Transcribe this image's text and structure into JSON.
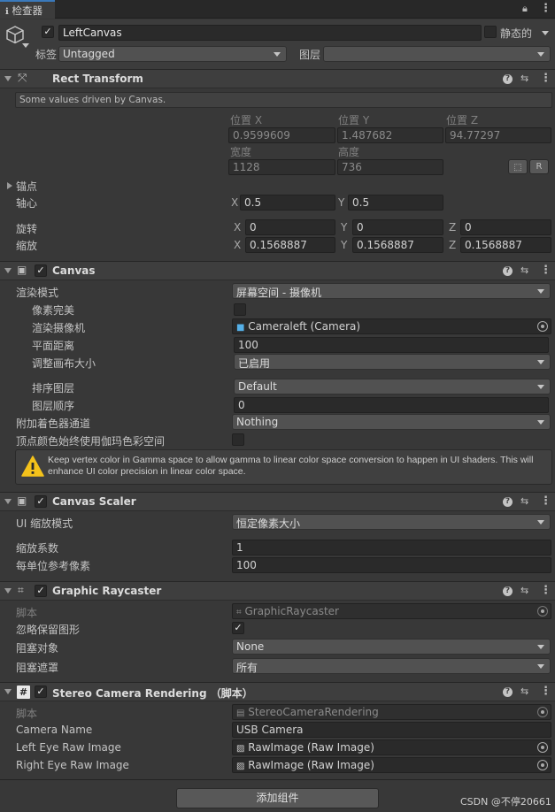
{
  "tab": {
    "label": "检查器"
  },
  "object": {
    "name": "LeftCanvas",
    "static_label": "静态的",
    "tag_label": "标签",
    "tag_value": "Untagged",
    "layer_label": "图层",
    "layer_value": ""
  },
  "rect_transform": {
    "title": "Rect Transform",
    "driven_note": "Some values driven by Canvas.",
    "pos_x_label": "位置 X",
    "pos_y_label": "位置 Y",
    "pos_z_label": "位置 Z",
    "pos_x": "0.9599609",
    "pos_y": "1.487682",
    "pos_z": "94.77297",
    "width_label": "宽度",
    "height_label": "高度",
    "width": "1128",
    "height": "736",
    "r_button": "R",
    "anchor_label": "锚点",
    "pivot_label": "轴心",
    "pivot_x": "0.5",
    "pivot_y": "0.5",
    "rotation_label": "旋转",
    "rot_x": "0",
    "rot_y": "0",
    "rot_z": "0",
    "scale_label": "缩放",
    "scale_x": "0.1568887",
    "scale_y": "0.1568887",
    "scale_z": "0.1568887",
    "x": "X",
    "y": "Y",
    "z": "Z"
  },
  "canvas": {
    "title": "Canvas",
    "render_mode_label": "渲染模式",
    "render_mode": "屏幕空间 - 摄像机",
    "pixel_perfect_label": "像素完美",
    "render_camera_label": "渲染摄像机",
    "render_camera": "Cameraleft (Camera)",
    "plane_distance_label": "平面距离",
    "plane_distance": "100",
    "resize_label": "调整画布大小",
    "resize_value": "已启用",
    "sorting_layer_label": "排序图层",
    "sorting_layer": "Default",
    "order_label": "图层顺序",
    "order": "0",
    "shader_channels_label": "附加着色器通道",
    "shader_channels": "Nothing",
    "gamma_label": "顶点颜色始终使用伽玛色彩空间",
    "warning": "Keep vertex color in Gamma space to allow gamma to linear color space conversion to happen in UI shaders. This will enhance UI color precision in linear color space."
  },
  "scaler": {
    "title": "Canvas Scaler",
    "scale_mode_label": "UI 缩放模式",
    "scale_mode": "恒定像素大小",
    "scale_factor_label": "缩放系数",
    "scale_factor": "1",
    "ref_ppu_label": "每单位参考像素",
    "ref_ppu": "100"
  },
  "raycaster": {
    "title": "Graphic Raycaster",
    "script_label": "脚本",
    "script": "GraphicRaycaster",
    "ignore_reversed_label": "忽略保留图形",
    "blocking_objects_label": "阻塞对象",
    "blocking_objects": "None",
    "blocking_mask_label": "阻塞遮罩",
    "blocking_mask": "所有"
  },
  "stereo": {
    "title": "Stereo Camera Rendering  （脚本）",
    "script_label": "脚本",
    "script": "StereoCameraRendering",
    "camera_name_label": "Camera Name",
    "camera_name": "USB Camera",
    "left_label": "Left Eye Raw Image",
    "left_value": "RawImage (Raw Image)",
    "right_label": "Right Eye Raw Image",
    "right_value": "RawImage (Raw Image)"
  },
  "add_component": "添加组件",
  "watermark": "CSDN @不停20661",
  "colors": {
    "accent": "#3a79bb",
    "background": "#383838",
    "header": "#3e3e3e",
    "field": "#2a2a2a",
    "warning": "#f4c21b"
  }
}
